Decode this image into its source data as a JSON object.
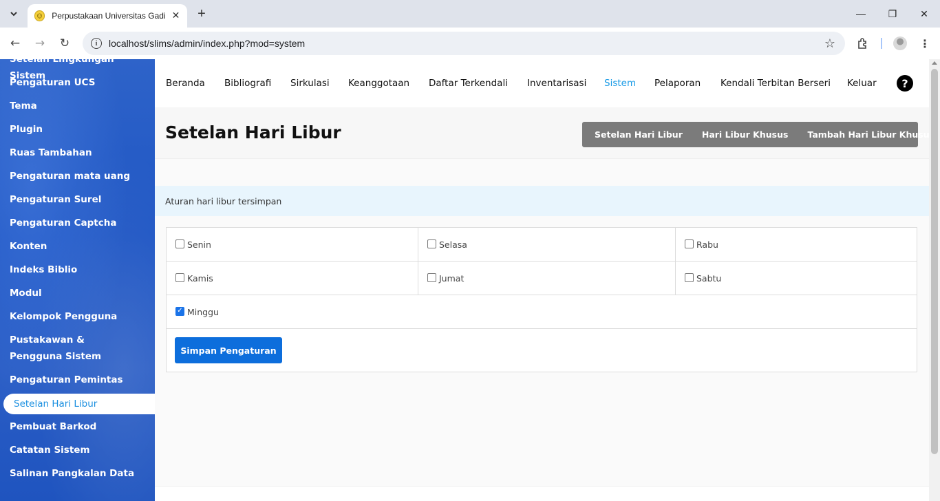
{
  "browser": {
    "tab_title": "Perpustakaan Universitas Gadin",
    "url": "localhost/slims/admin/index.php?mod=system",
    "new_tab_label": "+",
    "minimize": "—",
    "restore": "❐",
    "close": "✕"
  },
  "sidebar": {
    "partial_top": "Setelan Lingkungan Sistem",
    "items": [
      "Pengaturan UCS",
      "Tema",
      "Plugin",
      "Ruas Tambahan",
      "Pengaturan mata uang",
      "Pengaturan Surel",
      "Pengaturan Captcha",
      "Konten",
      "Indeks Biblio",
      "Modul",
      "Kelompok Pengguna",
      "Pustakawan & Pengguna Sistem",
      "Pengaturan Pemintas"
    ],
    "active": "Setelan Hari Libur",
    "items_after": [
      "Pembuat Barkod",
      "Catatan Sistem",
      "Salinan Pangkalan Data"
    ]
  },
  "topnav": {
    "items": [
      "Beranda",
      "Bibliografi",
      "Sirkulasi",
      "Keanggotaan",
      "Daftar Terkendali",
      "Inventarisasi",
      "Sistem",
      "Pelaporan",
      "Kendali Terbitan Berseri",
      "Keluar"
    ],
    "active": "Sistem",
    "help_label": "?"
  },
  "header": {
    "title": "Setelan Hari Libur",
    "buttons": [
      "Setelan Hari Libur",
      "Hari Libur Khusus",
      "Tambah Hari Libur Khusus"
    ]
  },
  "info_message": "Aturan hari libur tersimpan",
  "days": {
    "row1": [
      "Senin",
      "Selasa",
      "Rabu"
    ],
    "row2": [
      "Kamis",
      "Jumat",
      "Sabtu"
    ],
    "row3": [
      "Minggu"
    ],
    "checked": [
      "Minggu"
    ]
  },
  "save_button": "Simpan Pengaturan",
  "colors": {
    "sidebar_blue": "#2259c5",
    "active_link": "#1a9be6",
    "primary_button": "#0d6edc",
    "button_group": "#7b7b7b",
    "info_bg": "#e8f5fd"
  }
}
